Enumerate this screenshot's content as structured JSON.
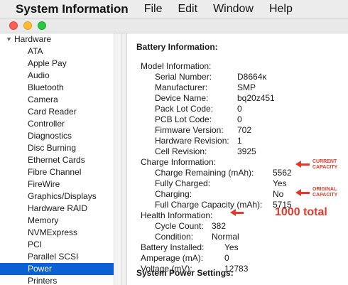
{
  "menubar": {
    "app": "System Information",
    "items": [
      "File",
      "Edit",
      "Window",
      "Help"
    ]
  },
  "colors": {
    "accent": "#0b60d4",
    "annotation": "#e03b2a"
  },
  "sidebar": {
    "header": "Hardware",
    "items": [
      "ATA",
      "Apple Pay",
      "Audio",
      "Bluetooth",
      "Camera",
      "Card Reader",
      "Controller",
      "Diagnostics",
      "Disc Burning",
      "Ethernet Cards",
      "Fibre Channel",
      "FireWire",
      "Graphics/Displays",
      "Hardware RAID",
      "Memory",
      "NVMExpress",
      "PCI",
      "Parallel SCSI",
      "Power",
      "Printers"
    ],
    "selected": "Power"
  },
  "content": {
    "title": "Battery Information:",
    "model_info_label": "Model Information:",
    "model": [
      {
        "label": "Serial Number:",
        "value": "D8664ĸ"
      },
      {
        "label": "Manufacturer:",
        "value": "SMP"
      },
      {
        "label": "Device Name:",
        "value": "bq20z451"
      },
      {
        "label": "Pack Lot Code:",
        "value": "0"
      },
      {
        "label": "PCB Lot Code:",
        "value": "0"
      },
      {
        "label": "Firmware Version:",
        "value": "702"
      },
      {
        "label": "Hardware Revision:",
        "value": "1"
      },
      {
        "label": "Cell Revision:",
        "value": "3925"
      }
    ],
    "charge_info_label": "Charge Information:",
    "charge": [
      {
        "label": "Charge Remaining (mAh):",
        "value": "5562"
      },
      {
        "label": "Fully Charged:",
        "value": "Yes"
      },
      {
        "label": "Charging:",
        "value": "No"
      },
      {
        "label": "Full Charge Capacity (mAh):",
        "value": "5715"
      }
    ],
    "health_info_label": "Health Information:",
    "health": [
      {
        "label": "Cycle Count:",
        "value": "382"
      },
      {
        "label": "Condition:",
        "value": "Normal"
      }
    ],
    "misc": [
      {
        "label": "Battery Installed:",
        "value": "Yes"
      },
      {
        "label": "Amperage (mA):",
        "value": "0"
      },
      {
        "label": "Voltage (mV):",
        "value": "12783"
      }
    ],
    "power_settings_title": "System Power Settings:"
  },
  "annotations": {
    "current_capacity": [
      "CURRENT",
      "CAPACITY"
    ],
    "original_capacity": [
      "ORIGINAL",
      "CAPACITY"
    ],
    "total": "1000 total"
  }
}
